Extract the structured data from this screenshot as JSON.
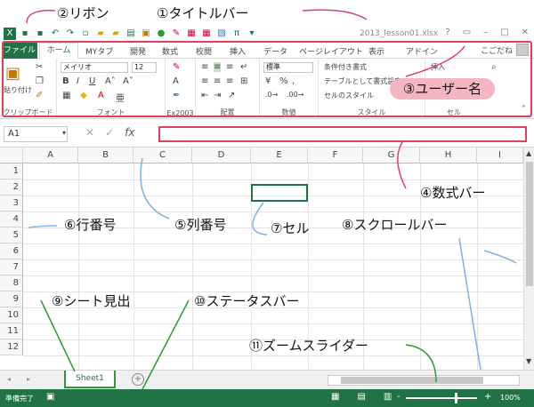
{
  "annotations": {
    "ribbon": "②リボン",
    "titlebar": "①タイトルバー",
    "username": "③ユーザー名",
    "formulabar": "④数式バー",
    "colnum": "⑤列番号",
    "rownum": "⑥行番号",
    "cell": "⑦セル",
    "scrollbar": "⑧スクロールバー",
    "sheettab": "⑨シート見出",
    "statusbar": "⑩ステータスバー",
    "zoomslider": "⑪ズームスライダー"
  },
  "window": {
    "filename": "2013_lesson01.xlsx",
    "controls": [
      "?",
      "▭",
      "–",
      "□",
      "✕"
    ]
  },
  "tabs": {
    "file": "ファイル",
    "home": "ホーム",
    "others": [
      "MYタブ",
      "開発",
      "数式",
      "校閲",
      "挿入",
      "データ",
      "ページレイアウト",
      "表示",
      "アドイン"
    ],
    "user": "こごだね"
  },
  "ribbon": {
    "clipboard": {
      "label": "クリップボード",
      "paste": "貼り付け"
    },
    "font": {
      "label": "フォント",
      "name": "メイリオ",
      "size": "12"
    },
    "ex2003": {
      "label": "Ex2003"
    },
    "align": {
      "label": "配置"
    },
    "number": {
      "label": "数値",
      "format": "標準"
    },
    "style": {
      "label": "スタイル",
      "items": [
        "条件付き書式",
        "テーブルとして書式設定",
        "セルのスタイル"
      ]
    },
    "cells": {
      "label": "セル",
      "insert": "挿入"
    }
  },
  "formula": {
    "namebox": "A1",
    "value": ""
  },
  "grid": {
    "columns": [
      "A",
      "B",
      "C",
      "D",
      "E",
      "F",
      "G",
      "H",
      "I"
    ],
    "rows": [
      "1",
      "2",
      "3",
      "4",
      "5",
      "6",
      "7",
      "8",
      "9",
      "10",
      "11",
      "12"
    ]
  },
  "sheet": {
    "tab": "Sheet1",
    "add": "+"
  },
  "status": {
    "text": "準備完了",
    "zoom": "100%",
    "zoom_minus": "-",
    "zoom_plus": "+"
  },
  "colors": {
    "excel_green": "#217346",
    "annotation_red": "#e04060",
    "annotation_blue": "#7fb0e8",
    "annotation_green": "#2f9a33",
    "username_bubble": "#f4b6c2"
  }
}
